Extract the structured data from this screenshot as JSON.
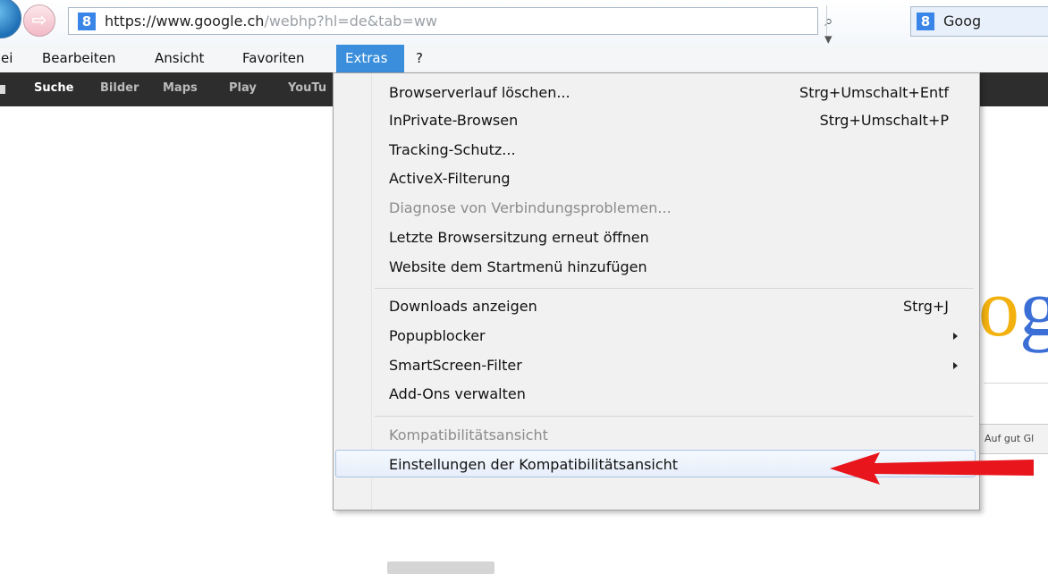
{
  "browser": {
    "url_prefix": "https://",
    "url_host": "www.google.ch",
    "url_path": "/webhp?hl=de&tab=ww",
    "tab_title": "Goog",
    "favicon": "8",
    "addr_icons": "⌕ ▾ 🔒 ↻ ✕",
    "nav_forward_icon": "⇨"
  },
  "menubar": {
    "items": [
      "ei",
      "Bearbeiten",
      "Ansicht",
      "Favoriten",
      "Extras",
      "?"
    ],
    "active_index": 4,
    "active_color": "#3a8edb"
  },
  "google_bar": {
    "links": [
      "Suche",
      "Bilder",
      "Maps",
      "Play",
      "YouTu"
    ]
  },
  "page": {
    "logo_fragment_o": "o",
    "logo_fragment_g": "g",
    "lucky_button": "Auf gut Gl"
  },
  "dropdown": {
    "items": [
      {
        "label": "Browserverlauf löschen...",
        "shortcut": "Strg+Umschalt+Entf"
      },
      {
        "label": "InPrivate-Browsen",
        "shortcut": "Strg+Umschalt+P"
      },
      {
        "label": "Tracking-Schutz...",
        "shortcut": ""
      },
      {
        "label": "ActiveX-Filterung",
        "shortcut": ""
      },
      {
        "label": "Diagnose von Verbindungsproblemen...",
        "shortcut": ""
      },
      {
        "label": "Letzte Browsersitzung erneut öffnen",
        "shortcut": ""
      },
      {
        "label": "Website dem Startmenü hinzufügen",
        "shortcut": ""
      },
      {
        "label": "Downloads anzeigen",
        "shortcut": "Strg+J"
      },
      {
        "label": "Popupblocker",
        "shortcut": ""
      },
      {
        "label": "SmartScreen-Filter",
        "shortcut": ""
      },
      {
        "label": "Add-Ons verwalten",
        "shortcut": ""
      },
      {
        "label": "Kompatibilitätsansicht",
        "shortcut": ""
      },
      {
        "label": "Einstellungen der Kompatibilitätsansicht",
        "shortcut": ""
      }
    ]
  },
  "annotation": {
    "arrow_color": "#e8161c"
  }
}
